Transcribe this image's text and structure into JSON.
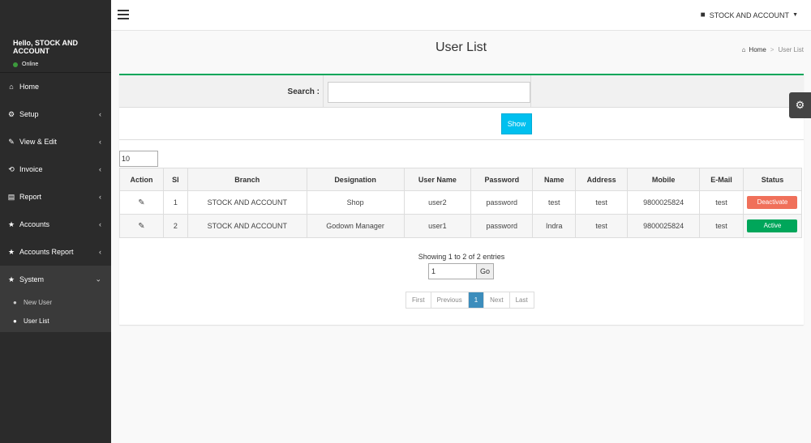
{
  "user_panel": {
    "greeting": "Hello, STOCK AND ACCOUNT",
    "status": "Online"
  },
  "sidebar": {
    "items": [
      {
        "label": "Home",
        "icon": "home-icon",
        "glyph": "⌂"
      },
      {
        "label": "Setup",
        "icon": "gears-icon",
        "glyph": "⚙"
      },
      {
        "label": "View & Edit",
        "icon": "edit-icon",
        "glyph": "✎"
      },
      {
        "label": "Invoice",
        "icon": "invoice-icon",
        "glyph": "⟲"
      },
      {
        "label": "Report",
        "icon": "report-icon",
        "glyph": "▤"
      },
      {
        "label": "Accounts",
        "icon": "star-icon",
        "glyph": "★"
      },
      {
        "label": "Accounts Report",
        "icon": "star-icon",
        "glyph": "★"
      },
      {
        "label": "System",
        "icon": "star-icon",
        "glyph": "★"
      }
    ],
    "submenu": [
      {
        "label": "New User",
        "icon": "user-icon",
        "glyph": "👤"
      },
      {
        "label": "User List",
        "icon": "users-icon",
        "glyph": "👥"
      }
    ]
  },
  "header": {
    "account": "STOCK AND ACCOUNT"
  },
  "page": {
    "title": "User List",
    "breadcrumb_home": "Home",
    "breadcrumb_sep": ">",
    "breadcrumb_current": "User List"
  },
  "search": {
    "label": "Search :",
    "value": "",
    "show_label": "Show"
  },
  "page_size": "10",
  "table": {
    "headers": [
      "Action",
      "Sl",
      "Branch",
      "Designation",
      "User Name",
      "Password",
      "Name",
      "Address",
      "Mobile",
      "E-Mail",
      "Status"
    ],
    "rows": [
      {
        "sl": "1",
        "branch": "STOCK AND ACCOUNT",
        "designation": "Shop",
        "username": "user2",
        "password": "password",
        "name": "test",
        "address": "test",
        "mobile": "9800025824",
        "email": "test",
        "status": "Deactivate",
        "status_color": "#f0705a"
      },
      {
        "sl": "2",
        "branch": "STOCK AND ACCOUNT",
        "designation": "Godown Manager",
        "username": "user1",
        "password": "password",
        "name": "Indra",
        "address": "test",
        "mobile": "9800025824",
        "email": "test",
        "status": "Active",
        "status_color": "#00a65a"
      }
    ]
  },
  "pagination": {
    "entries_text": "Showing 1 to 2 of 2 entries",
    "goto_value": "1",
    "go_label": "Go",
    "first": "First",
    "previous": "Previous",
    "current": "1",
    "next": "Next",
    "last": "Last"
  },
  "colors": {
    "accent": "#00a65a",
    "info": "#00c0ef",
    "danger": "#f0705a",
    "primary": "#3c8dbc",
    "sidebar": "#2b2b2b"
  }
}
